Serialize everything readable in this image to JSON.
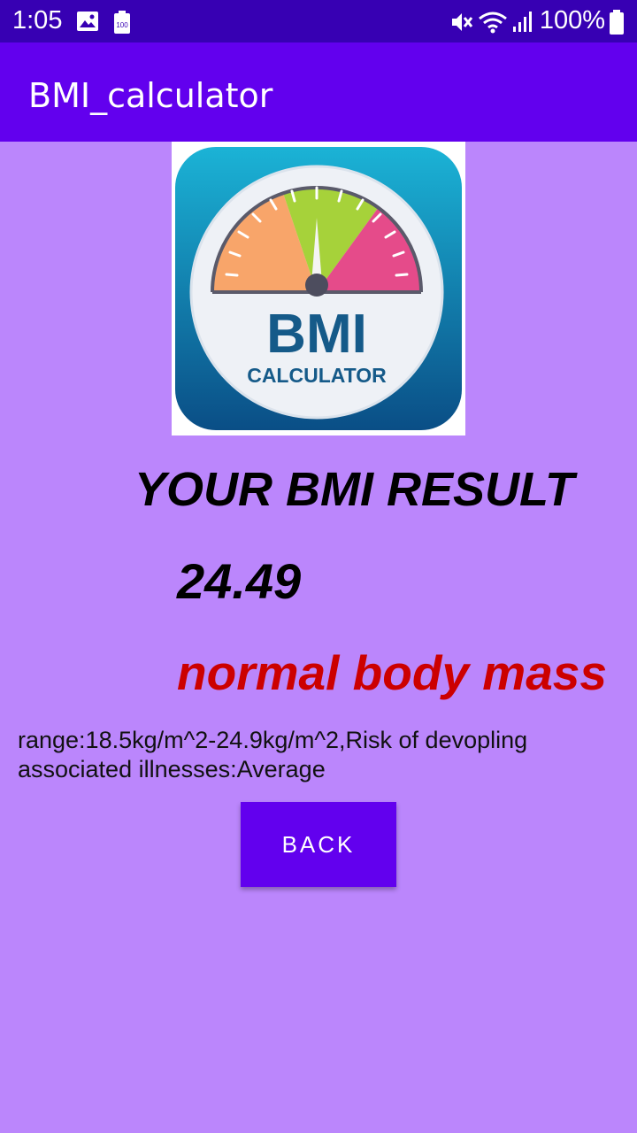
{
  "status_bar": {
    "time": "1:05",
    "battery_percent": "100%",
    "icons": [
      "image-icon",
      "battery-saver-icon",
      "mute-icon",
      "wifi-icon",
      "signal-icon",
      "battery-icon"
    ]
  },
  "app_bar": {
    "title": "BMI_calculator",
    "color": "#6200ee"
  },
  "logo": {
    "big_text": "BMI",
    "small_text": "CALCULATOR"
  },
  "result": {
    "title": "YOUR BMI RESULT",
    "value": "24.49",
    "category": "normal body mass",
    "category_color": "#cc0000",
    "description": "range:18.5kg/m^2-24.9kg/m^2,Risk of devopling associated illnesses:Average"
  },
  "actions": {
    "back_label": "BACK"
  },
  "colors": {
    "background": "#bb86fc",
    "status_bar": "#3700b3",
    "accent": "#6200ee"
  }
}
